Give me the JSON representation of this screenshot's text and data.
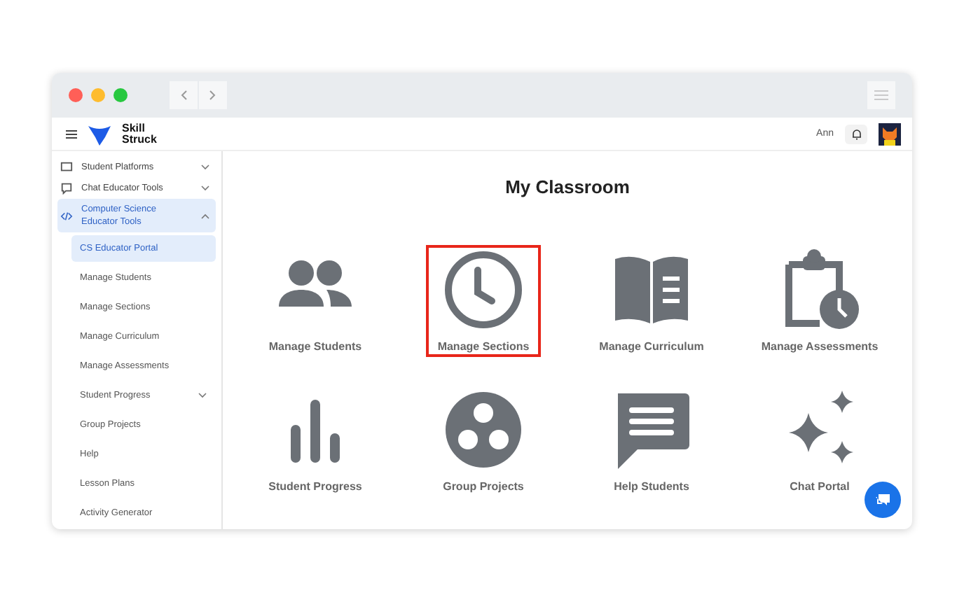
{
  "app": {
    "brand": "Skill Struck",
    "user_name": "Ann"
  },
  "sidebar": {
    "sections": [
      {
        "label": "Student Platforms",
        "expanded": false,
        "selected": false
      },
      {
        "label": "Chat Educator Tools",
        "expanded": false,
        "selected": false
      },
      {
        "label": "Computer Science Educator Tools",
        "expanded": true,
        "selected": true,
        "children": [
          {
            "label": "CS Educator Portal",
            "selected": true
          },
          {
            "label": "Manage Students",
            "selected": false
          },
          {
            "label": "Manage Sections",
            "selected": false
          },
          {
            "label": "Manage Curriculum",
            "selected": false
          },
          {
            "label": "Manage Assessments",
            "selected": false
          },
          {
            "label": "Student Progress",
            "selected": false,
            "expanded": false
          },
          {
            "label": "Group Projects",
            "selected": false
          },
          {
            "label": "Help",
            "selected": false
          },
          {
            "label": "Lesson Plans",
            "selected": false
          },
          {
            "label": "Activity Generator",
            "selected": false
          }
        ]
      }
    ]
  },
  "main": {
    "title": "My Classroom",
    "tiles": [
      {
        "label": "Manage Students",
        "highlighted": false
      },
      {
        "label": "Manage Sections",
        "highlighted": true
      },
      {
        "label": "Manage Curriculum",
        "highlighted": false
      },
      {
        "label": "Manage Assessments",
        "highlighted": false
      },
      {
        "label": "Student Progress",
        "highlighted": false
      },
      {
        "label": "Group Projects",
        "highlighted": false
      },
      {
        "label": "Help Students",
        "highlighted": false
      },
      {
        "label": "Chat Portal",
        "highlighted": false
      }
    ]
  }
}
